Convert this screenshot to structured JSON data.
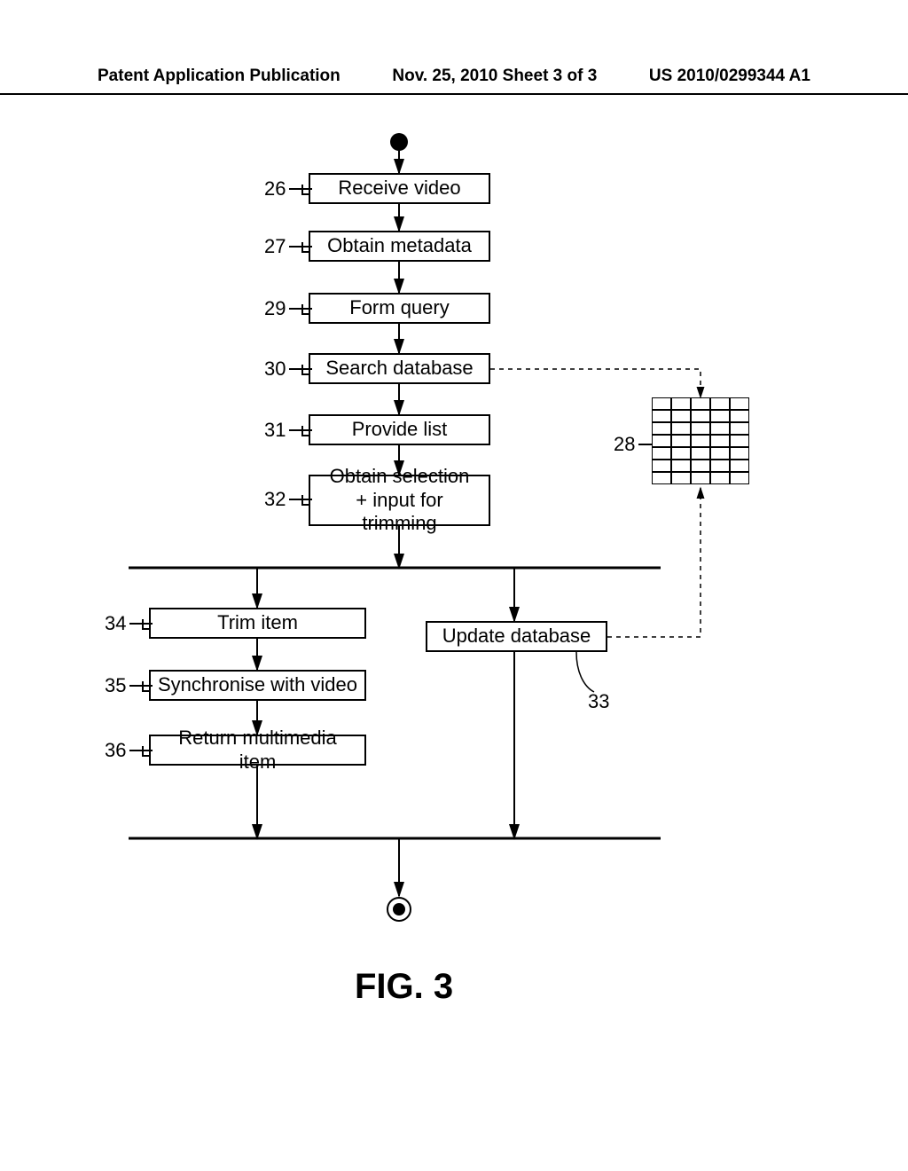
{
  "header": {
    "left": "Patent Application Publication",
    "center": "Nov. 25, 2010  Sheet 3 of 3",
    "right": "US 2010/0299344 A1"
  },
  "boxes": {
    "b26": "Receive video",
    "b27": "Obtain metadata",
    "b29": "Form query",
    "b30": "Search database",
    "b31": "Provide list",
    "b32": "Obtain selection\n+ input for trimming",
    "b34": "Trim item",
    "b35": "Synchronise with video",
    "b33": "Update database",
    "b36": "Return multimedia item"
  },
  "refs": {
    "r26": "26",
    "r27": "27",
    "r29": "29",
    "r30": "30",
    "r31": "31",
    "r32": "32",
    "r34": "34",
    "r35": "35",
    "r36": "36",
    "r28": "28",
    "r33": "33"
  },
  "figure": "FIG. 3"
}
